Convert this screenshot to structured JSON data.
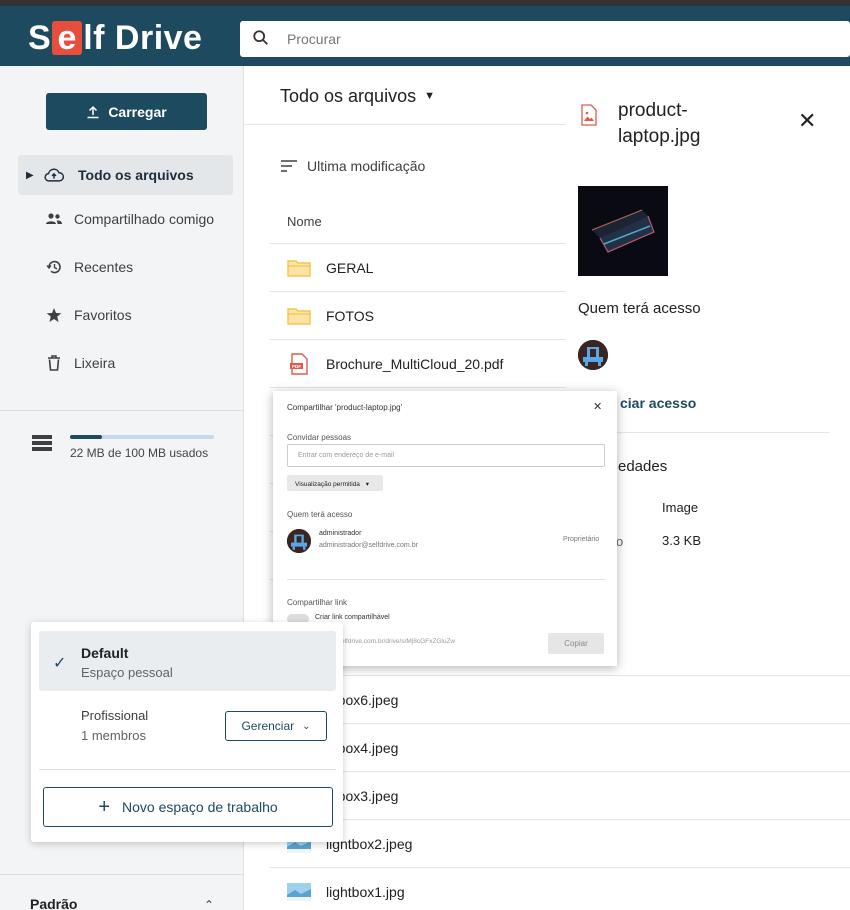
{
  "app": {
    "logo_prefix": "S",
    "logo_e": "e",
    "logo_suffix": "lf Drive"
  },
  "search": {
    "placeholder": "Procurar"
  },
  "sidebar": {
    "upload_label": "Carregar",
    "items": [
      {
        "label": "Todo os arquivos",
        "icon": "cloud-upload-icon"
      },
      {
        "label": "Compartilhado comigo",
        "icon": "people-icon"
      },
      {
        "label": "Recentes",
        "icon": "history-icon"
      },
      {
        "label": "Favoritos",
        "icon": "star-icon"
      },
      {
        "label": "Lixeira",
        "icon": "trash-icon"
      }
    ],
    "storage_text": "22 MB de 100 MB usados",
    "storage_used_fraction": 0.22,
    "footer_label": "Padrão"
  },
  "main": {
    "title": "Todo os arquivos",
    "sort_label": "Ultima modificação",
    "column_name": "Nome",
    "rows": [
      {
        "name": "GERAL",
        "icon": "folder-icon"
      },
      {
        "name": "FOTOS",
        "icon": "folder-icon"
      },
      {
        "name": "Brochure_MultiCloud_20.pdf",
        "icon": "pdf-icon"
      },
      {
        "name": "ntbox6.jpeg",
        "icon": "image-icon"
      },
      {
        "name": "ntbox4.jpeg",
        "icon": "image-icon"
      },
      {
        "name": "ntbox3.jpeg",
        "icon": "image-icon"
      },
      {
        "name": "lightbox2.jpeg",
        "icon": "image-icon"
      },
      {
        "name": "lightbox1.jpg",
        "icon": "image-icon"
      }
    ]
  },
  "details": {
    "file_name": "product-laptop.jpg",
    "access_label": "Quem terá acesso",
    "manage_access_text": "ciar acesso",
    "properties_title": "edades",
    "type_value": "Image",
    "size_label": "o",
    "size_value": "3.3 KB"
  },
  "share_dialog": {
    "title": "Compartilhar 'product-laptop.jpg'",
    "invite_label": "Convidar pessoas",
    "invite_placeholder": "Entrar com endereço de e-mail",
    "permission": "Visualização permitida",
    "who_label": "Quem terá acesso",
    "user_name": "administrador",
    "user_email": "administrador@selfdrive.com.br",
    "user_role": "Proprietário",
    "share_link_label": "Compartilhar link",
    "create_link_label": "Criar link compartilhável",
    "link_url": "elfdrive.com.br/drive/s/Mj8cGFxZGluZw",
    "copy_label": "Copiar"
  },
  "workspace_menu": {
    "default_name": "Default",
    "default_sub": "Espaço pessoal",
    "pro_name": "Profissional",
    "pro_sub": "1 membros",
    "manage_label": "Gerenciar",
    "new_label": "Novo espaço de trabalho"
  },
  "colors": {
    "brand": "#1e4a5f",
    "logo_accent": "#e84e3c",
    "folder": "#f5c451",
    "pdf": "#e05a4a"
  }
}
